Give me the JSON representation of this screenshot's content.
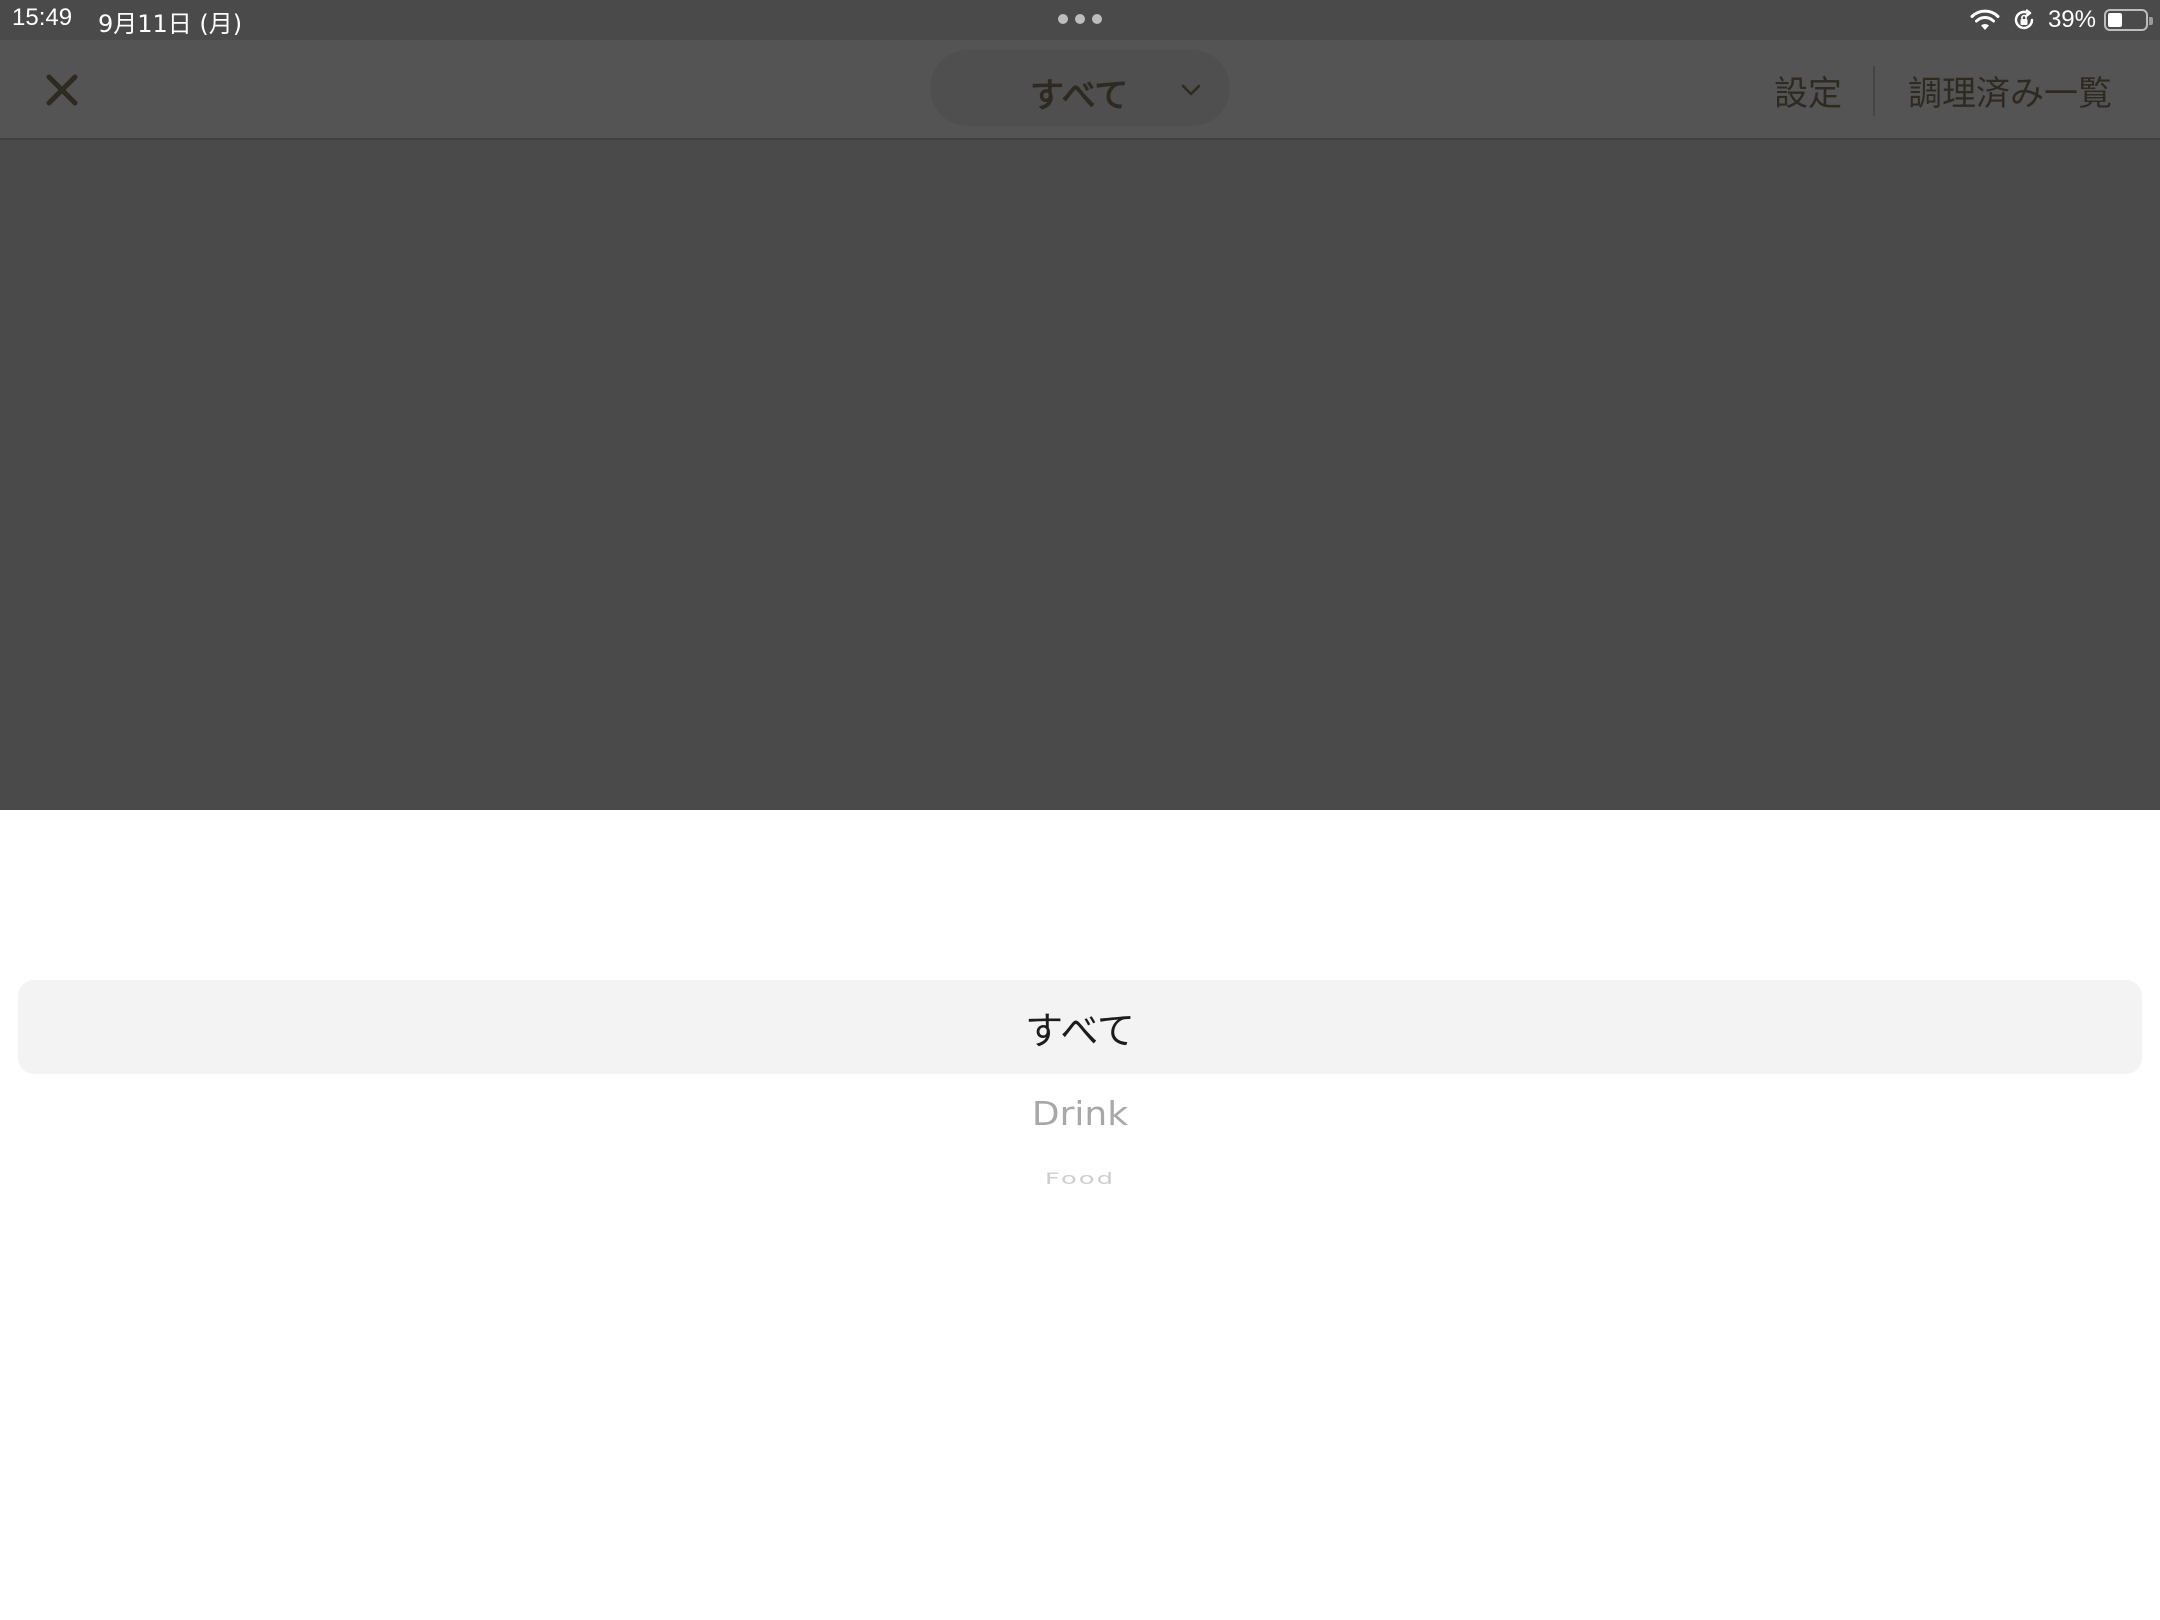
{
  "status_bar": {
    "time": "15:49",
    "date": "9月11日 (月)",
    "battery_percent": "39%",
    "battery_level": 0.39,
    "icons": [
      "wifi-icon",
      "orientation-lock-icon",
      "battery-icon"
    ]
  },
  "nav": {
    "close_icon": "close-icon",
    "category_selected": "すべて",
    "settings_label": "設定",
    "cooked_list_label": "調理済み一覧"
  },
  "picker": {
    "options": [
      "すべて",
      "Drink",
      "Food"
    ],
    "selected_index": 0
  },
  "colors": {
    "dim_overlay": "#4a4a4a",
    "nav_text": "#2e2a1f",
    "sheet_bg": "#ffffff",
    "selection_band": "#f3f3f3"
  }
}
